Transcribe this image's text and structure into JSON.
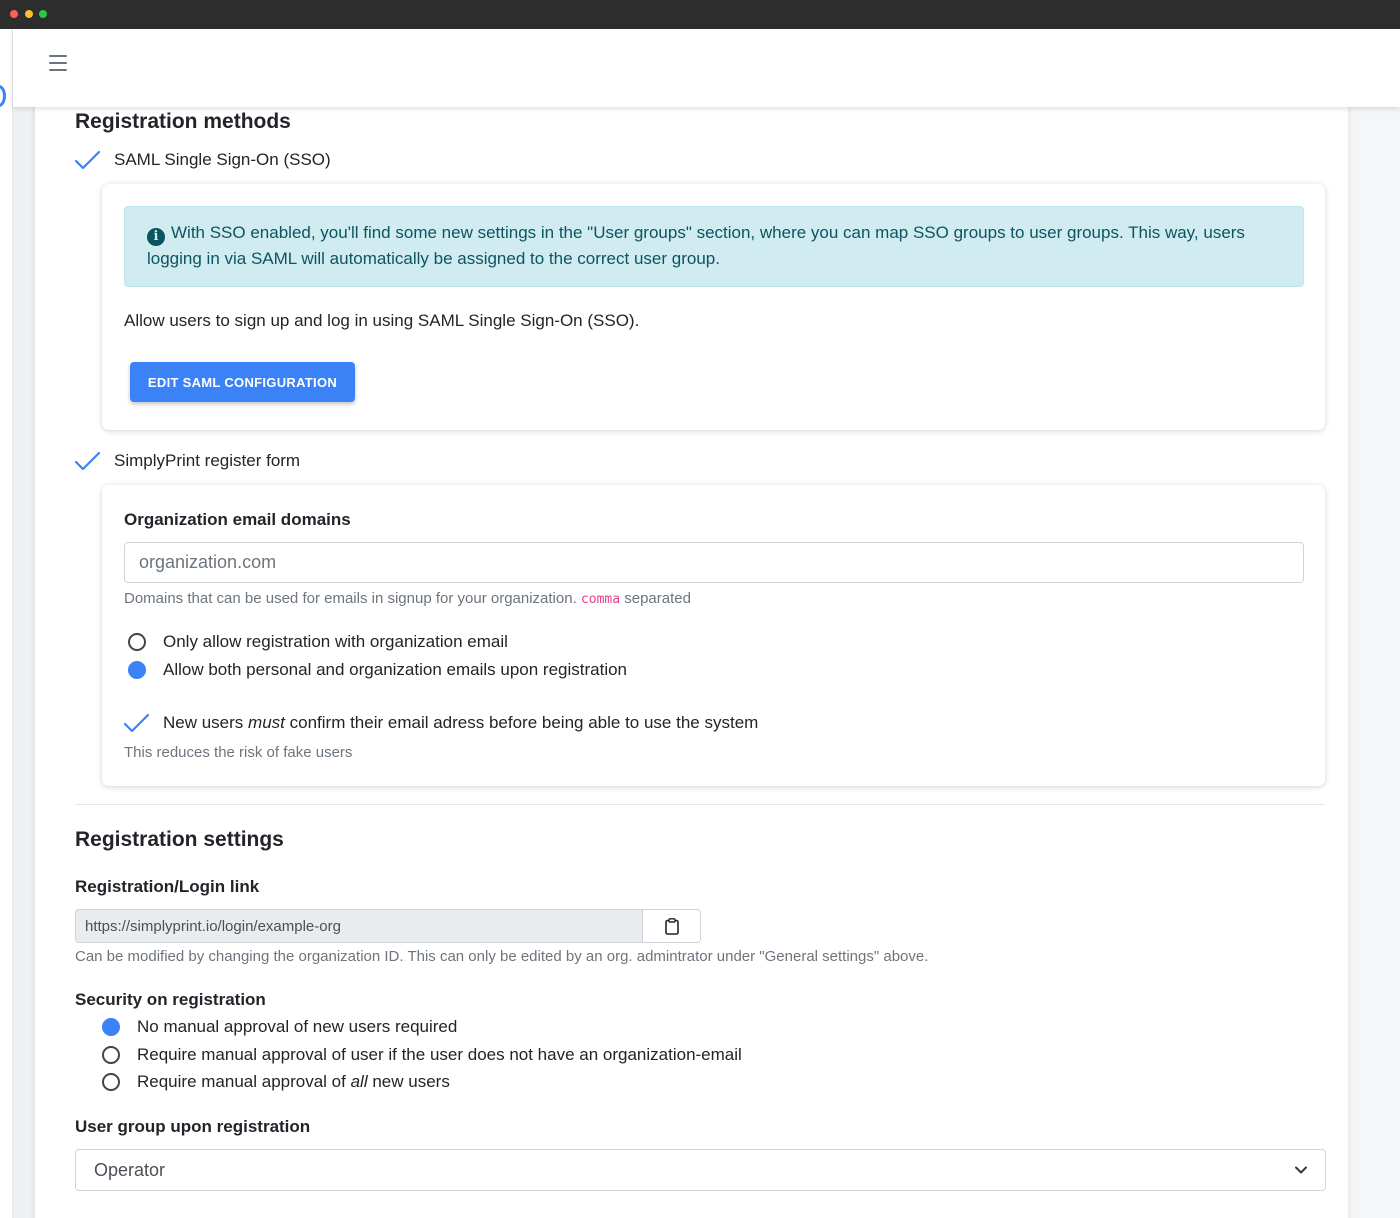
{
  "header": {
    "menu_icon": "hamburger-icon"
  },
  "registration_methods": {
    "title": "Registration methods",
    "saml": {
      "label": "SAML Single Sign-On (SSO)",
      "alert": "With SSO enabled, you'll find some new settings in the \"User groups\" section, where you can map SSO groups to user groups. This way, users logging in via SAML will automatically be assigned to the correct user group.",
      "description": "Allow users to sign up and log in using SAML Single Sign-On (SSO).",
      "button_label": "EDIT SAML CONFIGURATION"
    },
    "register_form": {
      "label": "SimplyPrint register form",
      "domains_label": "Organization email domains",
      "domains_placeholder": "organization.com",
      "domains_help_pre": "Domains that can be used for emails in signup for your organization.",
      "domains_help_code": "comma",
      "domains_help_post": "separated",
      "radio_org_only": "Only allow registration with organization email",
      "radio_both": "Allow both personal and organization emails upon registration",
      "confirm_pre": "New users",
      "confirm_em": "must",
      "confirm_post": "confirm their email adress before being able to use the system",
      "confirm_help": "This reduces the risk of fake users"
    }
  },
  "registration_settings": {
    "title": "Registration settings",
    "link_label": "Registration/Login link",
    "link_value": "https://simplyprint.io/login/example-org",
    "link_help": "Can be modified by changing the organization ID. This can only be edited by an org. admintrator under \"General settings\" above.",
    "security_label": "Security on registration",
    "security_none": "No manual approval of new users required",
    "security_non_org": "Require manual approval of user if the user does not have an organization-email",
    "security_all_pre": "Require manual approval of",
    "security_all_em": "all",
    "security_all_post": "new users",
    "group_label": "User group upon registration",
    "group_selected": "Operator"
  },
  "colors": {
    "accent": "#3b82f6",
    "alert_bg": "#d1ecf1",
    "alert_text": "#0c5460"
  }
}
